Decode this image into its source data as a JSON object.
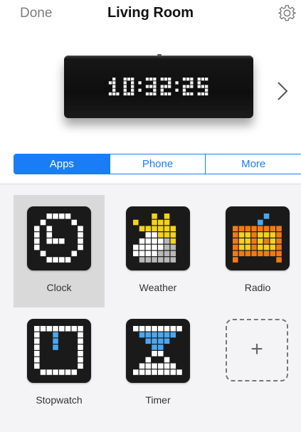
{
  "nav": {
    "done_label": "Done",
    "title": "Living Room",
    "settings_icon": "gear-icon"
  },
  "device": {
    "display_time": "10:32:25",
    "next_icon": "chevron-right-icon"
  },
  "tabs": [
    {
      "label": "Apps",
      "active": true
    },
    {
      "label": "Phone",
      "active": false
    },
    {
      "label": "More",
      "active": false
    }
  ],
  "apps": [
    {
      "label": "Clock",
      "icon": "clock-icon",
      "selected": true
    },
    {
      "label": "Weather",
      "icon": "weather-icon",
      "selected": false
    },
    {
      "label": "Radio",
      "icon": "radio-icon",
      "selected": false
    },
    {
      "label": "Stopwatch",
      "icon": "stopwatch-icon",
      "selected": false
    },
    {
      "label": "Timer",
      "icon": "timer-icon",
      "selected": false
    }
  ],
  "add_app": {
    "symbol": "+",
    "icon": "add-app-icon"
  },
  "colors": {
    "accent": "#1b7df6",
    "panel_bg": "#f4f4f6",
    "selected_tile": "#d9d9d9",
    "pixel_white": "#ffffff",
    "pixel_yellow": "#f6d21a",
    "pixel_gray": "#b9b9b9",
    "pixel_blue": "#4aa7f0",
    "pixel_orange": "#f07b14"
  }
}
